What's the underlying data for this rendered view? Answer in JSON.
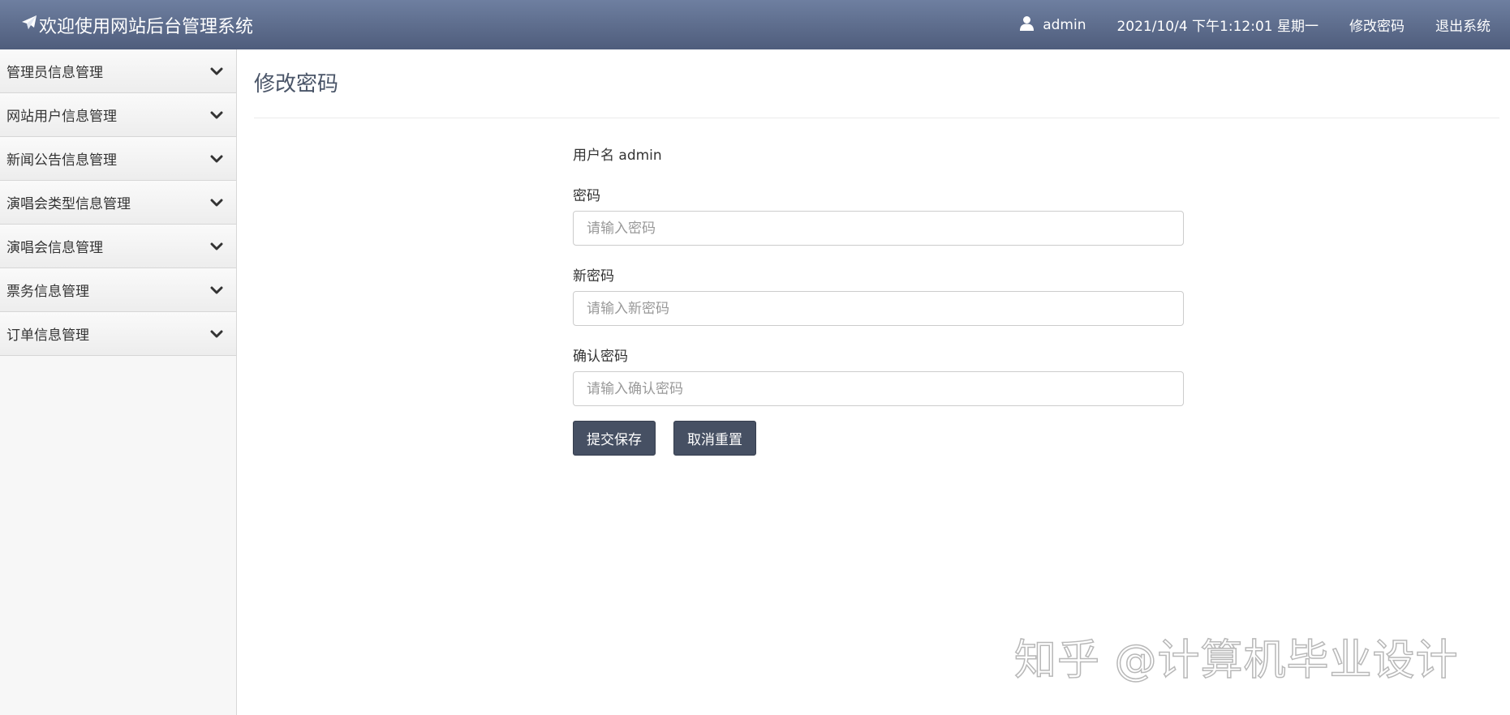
{
  "header": {
    "title": "欢迎使用网站后台管理系统",
    "username": "admin",
    "datetime": "2021/10/4 下午1:12:01 星期一",
    "change_password_link": "修改密码",
    "logout_link": "退出系统",
    "logo_icon": "paper-plane-icon",
    "user_icon": "user-icon"
  },
  "sidebar": {
    "items": [
      {
        "label": "管理员信息管理"
      },
      {
        "label": "网站用户信息管理"
      },
      {
        "label": "新闻公告信息管理"
      },
      {
        "label": "演唱会类型信息管理"
      },
      {
        "label": "演唱会信息管理"
      },
      {
        "label": "票务信息管理"
      },
      {
        "label": "订单信息管理"
      }
    ],
    "chevron_icon": "chevron-down-icon"
  },
  "main": {
    "title": "修改密码",
    "username_label": "用户名 admin",
    "fields": [
      {
        "label": "密码",
        "value": "",
        "placeholder": "请输入密码"
      },
      {
        "label": "新密码",
        "value": "",
        "placeholder": "请输入新密码"
      },
      {
        "label": "确认密码",
        "value": "",
        "placeholder": "请输入确认密码"
      }
    ],
    "submit_label": "提交保存",
    "reset_label": "取消重置"
  },
  "watermark": {
    "text": "知乎 @计算机毕业设计"
  },
  "colors": {
    "header_top": "#6e7fa0",
    "header_bottom": "#4f5d7c",
    "button_bg": "#465063",
    "title_color": "#4a5568"
  }
}
